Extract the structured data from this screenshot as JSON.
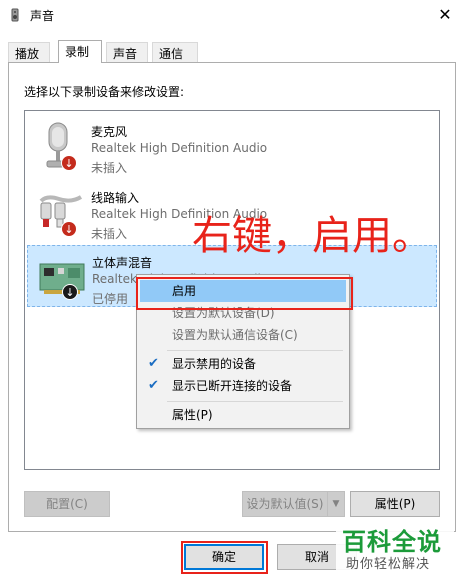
{
  "window": {
    "title": "声音",
    "close_glyph": "✕"
  },
  "tabs": [
    {
      "label": "播放",
      "active": false
    },
    {
      "label": "录制",
      "active": true
    },
    {
      "label": "声音",
      "active": false
    },
    {
      "label": "通信",
      "active": false
    }
  ],
  "prompt": "选择以下录制设备来修改设置:",
  "devices": [
    {
      "name": "麦克风",
      "driver": "Realtek High Definition Audio",
      "status": "未插入",
      "icon": "microphone-icon",
      "badge": "unplugged-badge"
    },
    {
      "name": "线路输入",
      "driver": "Realtek High Definition Audio",
      "status": "未插入",
      "icon": "line-in-icon",
      "badge": "unplugged-badge"
    },
    {
      "name": "立体声混音",
      "driver": "Realtek High Definition Audio",
      "status": "已停用",
      "icon": "stereo-mix-icon",
      "badge": "disabled-badge"
    }
  ],
  "annotation": "右键，启用。",
  "context_menu": {
    "items": [
      {
        "label": "启用",
        "highlighted": true,
        "enabled": true,
        "checked": false
      },
      {
        "label": "设置为默认设备(D)",
        "highlighted": false,
        "enabled": false,
        "checked": false
      },
      {
        "label": "设置为默认通信设备(C)",
        "highlighted": false,
        "enabled": false,
        "checked": false
      },
      {
        "label": "显示禁用的设备",
        "highlighted": false,
        "enabled": true,
        "checked": true
      },
      {
        "label": "显示已断开连接的设备",
        "highlighted": false,
        "enabled": true,
        "checked": true
      },
      {
        "label": "属性(P)",
        "highlighted": false,
        "enabled": true,
        "checked": false
      }
    ],
    "check_glyph": "✔"
  },
  "buttons": {
    "configure": "配置(C)",
    "set_default": "设为默认值(S)",
    "properties": "属性(P)",
    "ok": "确定",
    "cancel": "取消",
    "dropdown_glyph": "▼"
  },
  "watermark": {
    "main": "百科全说",
    "sub": "助你轻松解决"
  },
  "colors": {
    "accent": "#0078d7",
    "annotation_red": "#e8231a",
    "selection": "#cce8ff",
    "menu_highlight": "#91c9f7",
    "watermark_green": "#1c9b3a"
  }
}
